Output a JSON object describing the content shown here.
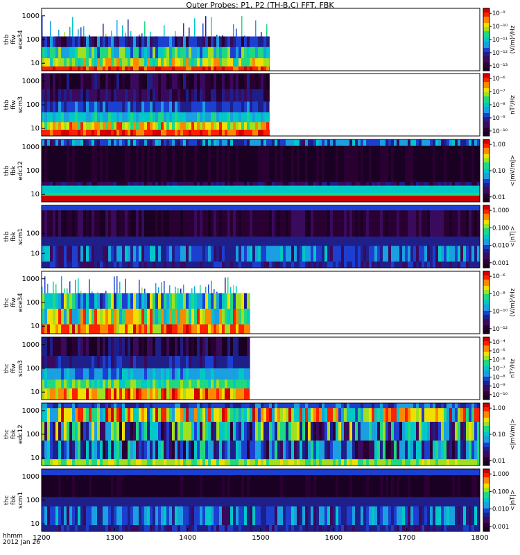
{
  "title": "Outer Probes: P1, P2 (TH-B,C) FFT, FBK",
  "footer": {
    "line1": "hhmm",
    "line2": "2012 Jan 26"
  },
  "colors": {
    "spectrum": [
      "#1a0022",
      "#2a0033",
      "#3a0a5c",
      "#1f1f8a",
      "#1d3fd0",
      "#1aa0e0",
      "#00c8c8",
      "#20d880",
      "#a0e020",
      "#f0e000",
      "#ff8800",
      "#ff2000",
      "#d00000"
    ]
  },
  "chart_data": {
    "type": "heatmap",
    "x_ticks": [
      "1200",
      "1300",
      "1400",
      "1500",
      "1600",
      "1700",
      "1800"
    ],
    "panels": [
      {
        "label": [
          "thb",
          "ffw",
          "ece34"
        ],
        "y_ticks": [
          "1000",
          "100",
          "10"
        ],
        "colorbar_ticks": [
          "10⁻⁹",
          "10⁻¹⁰",
          "10⁻¹¹",
          "10⁻¹²",
          "10⁻¹³"
        ],
        "colorbar_label": "(V/m)²/Hz",
        "data_end": 1512,
        "profile": "ffw_e"
      },
      {
        "label": [
          "thb",
          "ffw",
          "scm3"
        ],
        "y_ticks": [
          "1000",
          "100",
          "10"
        ],
        "colorbar_ticks": [
          "10⁻⁶",
          "10⁻⁷",
          "10⁻⁸",
          "10⁻⁹",
          "10⁻¹⁰"
        ],
        "colorbar_label": "nT²/Hz",
        "data_end": 1512,
        "profile": "ffw_b"
      },
      {
        "label": [
          "thb",
          "fbk",
          "edc12"
        ],
        "y_ticks": [
          "1000",
          "100",
          "10"
        ],
        "colorbar_ticks": [
          "1.00",
          "0.10",
          "0.01"
        ],
        "colorbar_label": "<|mV/m|>",
        "data_end": 1800,
        "profile": "fbk_e"
      },
      {
        "label": [
          "thb",
          "fbk",
          "scm1"
        ],
        "y_ticks": [
          "100",
          "10"
        ],
        "colorbar_ticks": [
          "1.000",
          "0.100",
          "0.010",
          "0.001"
        ],
        "colorbar_label": "<|nT|>",
        "data_end": 1800,
        "profile": "fbk_b"
      },
      {
        "label": [
          "thc",
          "ffw",
          "ece34"
        ],
        "y_ticks": [
          "1000",
          "100",
          "10"
        ],
        "colorbar_ticks": [
          "10⁻⁶",
          "10⁻⁸",
          "10⁻¹⁰",
          "10⁻¹²"
        ],
        "colorbar_label": "(V/m)²/Hz",
        "data_end": 1485,
        "profile": "ffw_e2"
      },
      {
        "label": [
          "thc",
          "ffw",
          "scm3"
        ],
        "y_ticks": [
          "1000",
          "100",
          "10"
        ],
        "colorbar_ticks": [
          "10⁻⁴",
          "10⁻⁵",
          "10⁻⁶",
          "10⁻⁷",
          "10⁻⁸",
          "10⁻⁹",
          "10⁻¹⁰"
        ],
        "colorbar_label": "nT²/Hz",
        "data_end": 1485,
        "profile": "ffw_b2"
      },
      {
        "label": [
          "thc",
          "fbk",
          "edc12"
        ],
        "y_ticks": [
          "1000",
          "100",
          "10"
        ],
        "colorbar_ticks": [
          "1.00",
          "0.10",
          "0.01"
        ],
        "colorbar_label": "<|mV/m|>",
        "data_end": 1800,
        "profile": "fbk_e2"
      },
      {
        "label": [
          "thc",
          "fbk",
          "scm1"
        ],
        "y_ticks": [
          "1000",
          "100",
          "10"
        ],
        "colorbar_ticks": [
          "1.000",
          "0.100",
          "0.010",
          "0.001"
        ],
        "colorbar_label": "<|nT|>",
        "data_end": 1800,
        "profile": "fbk_b2"
      }
    ]
  }
}
